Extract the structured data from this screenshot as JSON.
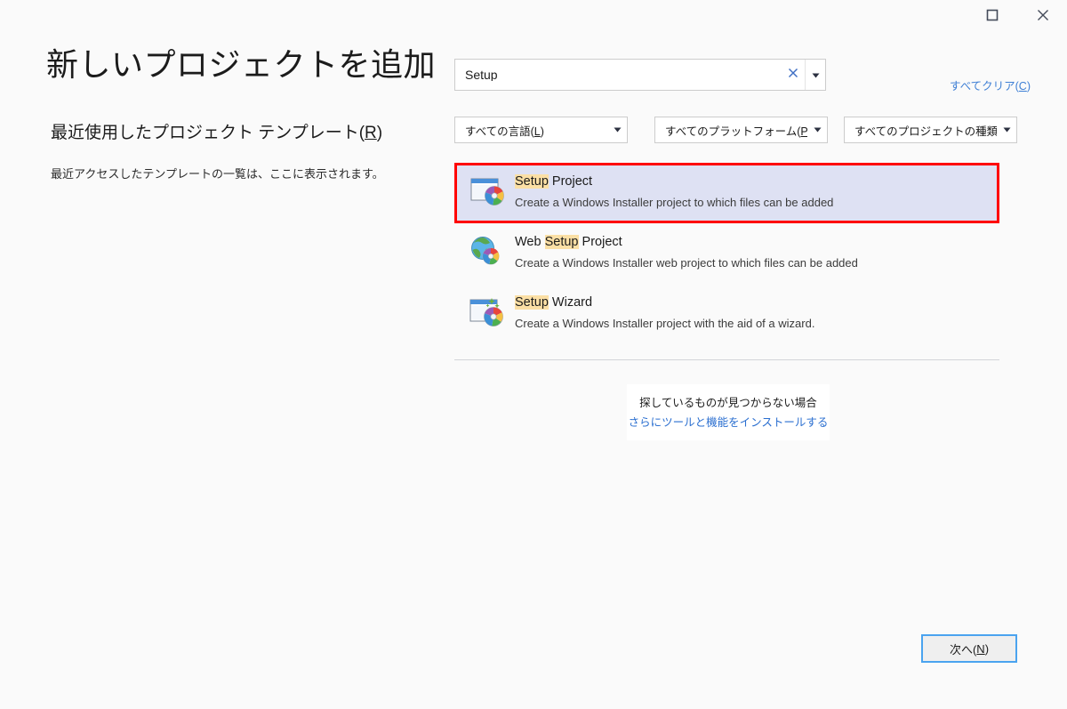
{
  "window": {
    "maximize_icon": "maximize-icon",
    "close_icon": "close-icon"
  },
  "left": {
    "title": "新しいプロジェクトを追加",
    "recent_heading": "最近使用したプロジェクト テンプレート(",
    "recent_heading_accel": "R",
    "recent_heading_tail": ")",
    "recent_empty": "最近アクセスしたテンプレートの一覧は、ここに表示されます。"
  },
  "search": {
    "value": "Setup",
    "clear_icon": "close-icon",
    "dropdown_icon": "chevron-down-icon"
  },
  "clear_all": {
    "text": "すべてクリア(",
    "accel": "C",
    "tail": ")"
  },
  "filters": [
    {
      "label": "すべての言語(",
      "accel": "L",
      "tail": ")"
    },
    {
      "label": "すべてのプラットフォーム(",
      "accel": "P",
      "tail": ")"
    },
    {
      "label": "すべてのプロジェクトの種類...",
      "accel": "",
      "tail": ""
    }
  ],
  "templates": [
    {
      "title_pre": "",
      "title_match": "Setup",
      "title_post": " Project",
      "description": "Create a Windows Installer project to which files can be added",
      "icon": "setup-project-icon",
      "selected": true
    },
    {
      "title_pre": "Web ",
      "title_match": "Setup",
      "title_post": " Project",
      "description": "Create a Windows Installer web project to which files can be added",
      "icon": "web-setup-project-icon",
      "selected": false
    },
    {
      "title_pre": "",
      "title_match": "Setup",
      "title_post": " Wizard",
      "description": "Create a Windows Installer project with the aid of a wizard.",
      "icon": "setup-wizard-icon",
      "selected": false
    }
  ],
  "not_found": {
    "text": "探しているものが見つからない場合",
    "link": "さらにツールと機能をインストールする"
  },
  "next_button": {
    "label": "次へ(",
    "accel": "N",
    "tail": ")"
  },
  "colors": {
    "background": "#fafafa",
    "selection": "#dee1f3",
    "annotation_border": "#ff0000",
    "match_highlight": "#fbdfa5",
    "link": "#2b6fd0",
    "focus_border": "#4aa3ef"
  }
}
